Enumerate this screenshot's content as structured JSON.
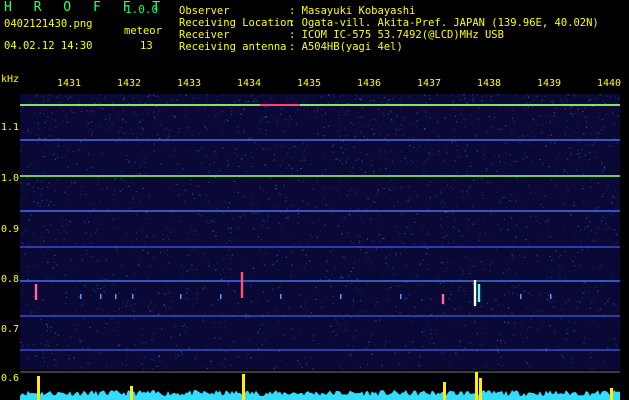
{
  "header": {
    "app_name": "H R O F F T",
    "version": "1.0.0",
    "filename": "0402121430.png",
    "datetime": "04.02.12 14:30",
    "meteor_label": "meteor",
    "meteor_count": "13",
    "fields": [
      {
        "label": "Observer",
        "value": ": Masayuki Kobayashi"
      },
      {
        "label": "Receiving Location",
        "value": ": Ogata-vill. Akita-Pref. JAPAN (139.96E, 40.02N)"
      },
      {
        "label": "Receiver",
        "value": ": ICOM IC-575 53.7492(@LCD)MHz USB"
      },
      {
        "label": "Receiving antenna",
        "value": ": A504HB(yagi 4el)"
      }
    ]
  },
  "axes": {
    "y_unit": "kHz",
    "y_ticks": [
      "1.1",
      "1.0",
      "0.9",
      "0.8",
      "0.7",
      "0.6"
    ],
    "x_ticks": [
      "1431",
      "1432",
      "1433",
      "1434",
      "1435",
      "1436",
      "1437",
      "1438",
      "1439",
      "1440"
    ]
  },
  "colors": {
    "background": "#000000",
    "plot_bg": "#0a0835",
    "text_yellow": "#ffff00",
    "text_green": "#33ff66",
    "line_green": "#8cff66",
    "line_blue": "#4466ff",
    "strip_cyan": "#33ddff",
    "meteor_yellow": "#ffee00"
  }
}
